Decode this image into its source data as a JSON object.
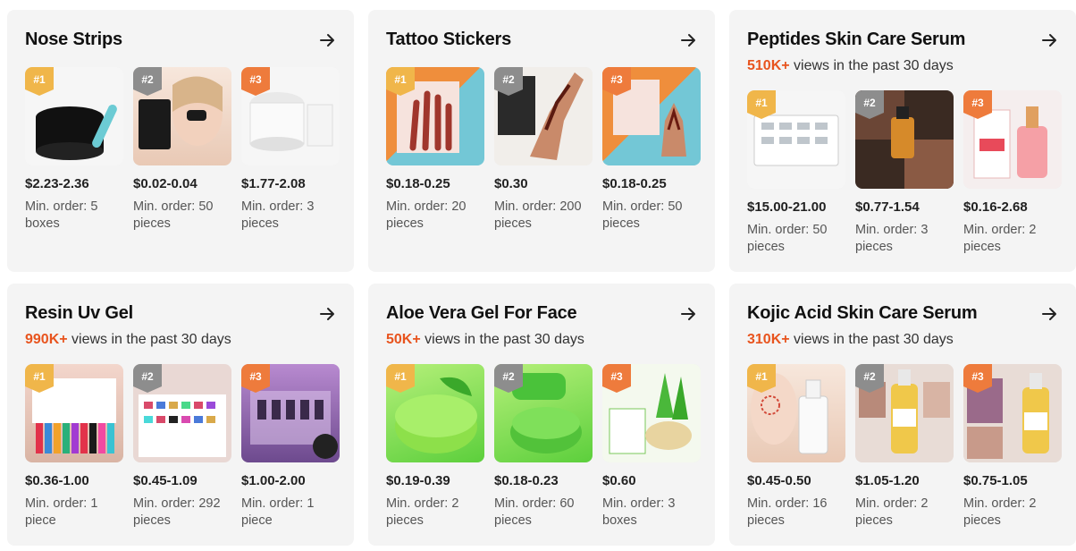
{
  "cards": [
    {
      "title": "Nose Strips",
      "views_count": "",
      "views_text": "",
      "products": [
        {
          "rank": "#1",
          "price": "$2.23-2.36",
          "moq": "Min. order: 5 boxes",
          "icon": "blackhead-remover-jar-image"
        },
        {
          "rank": "#2",
          "price": "$0.02-0.04",
          "moq": "Min. order: 50 pieces",
          "icon": "nose-strip-model-image"
        },
        {
          "rank": "#3",
          "price": "$1.77-2.08",
          "moq": "Min. order: 3 pieces",
          "icon": "lanbena-jar-image"
        }
      ]
    },
    {
      "title": "Tattoo Stickers",
      "views_count": "",
      "views_text": "",
      "products": [
        {
          "rank": "#1",
          "price": "$0.18-0.25",
          "moq": "Min. order: 20 pieces",
          "icon": "henna-sticker-image"
        },
        {
          "rank": "#2",
          "price": "$0.30",
          "moq": "Min. order: 200 pieces",
          "icon": "henna-hand-image"
        },
        {
          "rank": "#3",
          "price": "$0.18-0.25",
          "moq": "Min. order: 50 pieces",
          "icon": "henna-sticker-image"
        }
      ]
    },
    {
      "title": "Peptides Skin Care Serum",
      "views_count": "510K+",
      "views_text": " views in the past 30 days",
      "products": [
        {
          "rank": "#1",
          "price": "$15.00-21.00",
          "moq": "Min. order: 50 pieces",
          "icon": "ampoule-set-image"
        },
        {
          "rank": "#2",
          "price": "$0.77-1.54",
          "moq": "Min. order: 3 pieces",
          "icon": "serum-before-after-image"
        },
        {
          "rank": "#3",
          "price": "$0.16-2.68",
          "moq": "Min. order: 2 pieces",
          "icon": "pink-serum-bottle-image"
        }
      ]
    },
    {
      "title": "Resin Uv Gel",
      "views_count": "990K+",
      "views_text": " views in the past 30 days",
      "products": [
        {
          "rank": "#1",
          "price": "$0.36-1.00",
          "moq": "Min. order: 1 piece",
          "icon": "gel-polish-box-image"
        },
        {
          "rank": "#2",
          "price": "$0.45-1.09",
          "moq": "Min. order: 292 pieces",
          "icon": "color-chart-image"
        },
        {
          "rank": "#3",
          "price": "$1.00-2.00",
          "moq": "Min. order: 1 piece",
          "icon": "gel-polish-set-image"
        }
      ]
    },
    {
      "title": "Aloe Vera Gel For Face",
      "views_count": "50K+",
      "views_text": " views in the past 30 days",
      "products": [
        {
          "rank": "#1",
          "price": "$0.19-0.39",
          "moq": "Min. order: 2 pieces",
          "icon": "aloe-jar-image"
        },
        {
          "rank": "#2",
          "price": "$0.18-0.23",
          "moq": "Min. order: 60 pieces",
          "icon": "aloe-gel-image"
        },
        {
          "rank": "#3",
          "price": "$0.60",
          "moq": "Min. order: 3 boxes",
          "icon": "aloe-snail-gel-image"
        }
      ]
    },
    {
      "title": "Kojic Acid Skin Care Serum",
      "views_count": "310K+",
      "views_text": " views in the past 30 days",
      "products": [
        {
          "rank": "#1",
          "price": "$0.45-0.50",
          "moq": "Min. order: 16 pieces",
          "icon": "serum-face-image"
        },
        {
          "rank": "#2",
          "price": "$1.05-1.20",
          "moq": "Min. order: 2 pieces",
          "icon": "peeling-oil-image"
        },
        {
          "rank": "#3",
          "price": "$0.75-1.05",
          "moq": "Min. order: 2 pieces",
          "icon": "peeling-oil-image"
        }
      ]
    }
  ],
  "colors": {
    "views_accent": "#e8541e",
    "rank_1": "#f0b64a",
    "rank_2": "#8d8d8d",
    "rank_3": "#ee7b3c"
  }
}
